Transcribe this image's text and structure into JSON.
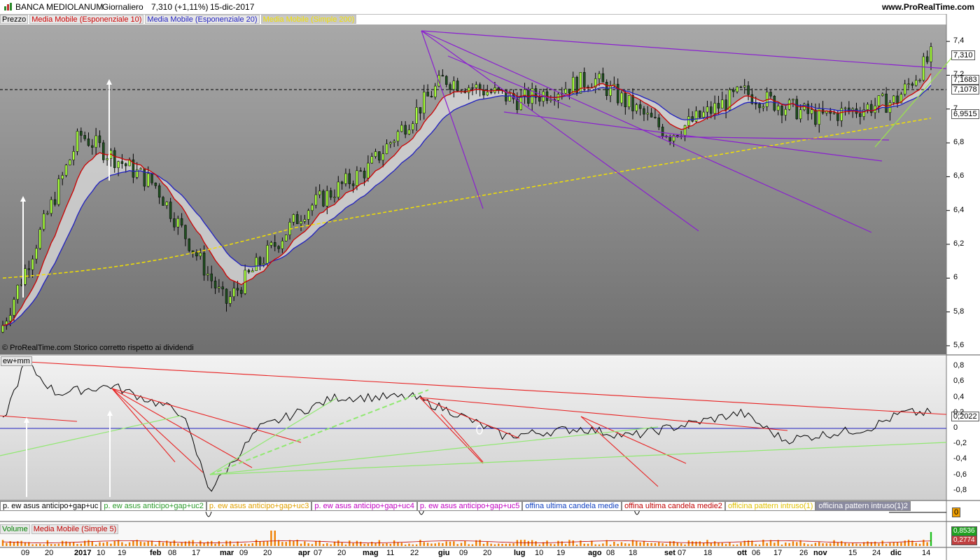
{
  "header": {
    "instrument": "BANCA MEDIOLANUM",
    "timeframe": "Giornaliero",
    "quote": "7,310 (+1,11%)",
    "date": "15-dic-2017",
    "site": "www.ProRealTime.com"
  },
  "legend": [
    {
      "label": "Prezzo",
      "color": "#000000"
    },
    {
      "label": "Media Mobile (Esponenziale 10)",
      "color": "#cc0000"
    },
    {
      "label": "Media Mobile (Esponenziale 20)",
      "color": "#1f1fbf"
    },
    {
      "label": "Media Mobile (Simple 200)",
      "color": "#f2e000"
    }
  ],
  "footnote": "© ProRealTime.com  Storico corretto rispetto ai dividendi",
  "price_axis": [
    "7,4",
    "7,2",
    "7",
    "6,8",
    "6,6",
    "6,4",
    "6,2",
    "6",
    "5,8",
    "5,6"
  ],
  "price_boxes": [
    {
      "value": "7,310",
      "bg": "#f2e000",
      "fg": "#000000"
    },
    {
      "value": "7,1683",
      "bg": "#c04040",
      "fg": "#ffffff"
    },
    {
      "value": "7,1078",
      "bg": "#2020c0",
      "fg": "#ffffff"
    },
    {
      "value": "6,9515",
      "bg": "#f2e000",
      "fg": "#000000"
    }
  ],
  "osc": {
    "name": "ew+mm",
    "axis": [
      "0,8",
      "0,6",
      "0,4",
      "0,2",
      "0",
      "-0,2",
      "-0,4",
      "-0,6",
      "-0,8"
    ],
    "last_value": "0,2022"
  },
  "signals": [
    {
      "label": "p. ew asus anticipo+gap+uc",
      "color": "#000000"
    },
    {
      "label": "p. ew asus anticipo+gap+uc2",
      "color": "#2a9a2a"
    },
    {
      "label": "p. ew asus anticipo+gap+uc3",
      "color": "#e0a000"
    },
    {
      "label": "p. ew asus anticipo+gap+uc4",
      "color": "#c000c0"
    },
    {
      "label": "p. ew asus anticipo+gap+uc5",
      "color": "#c000c0"
    },
    {
      "label": "offina ultima candela medie",
      "color": "#1040c0"
    },
    {
      "label": "offina ultima candela medie2",
      "color": "#c00000"
    },
    {
      "label": "officina pattern intruso(1)",
      "color": "#e0c000"
    },
    {
      "label": "officina pattern intruso(1)2",
      "color": "#ffffff"
    }
  ],
  "signal_value": "0",
  "volume": {
    "legend": [
      {
        "label": "Volume",
        "color": "#008000"
      },
      {
        "label": "Media Mobile (Simple 5)",
        "color": "#c00000"
      }
    ],
    "boxes": [
      {
        "value": "0,8536",
        "bg": "#20a020"
      },
      {
        "value": "0,2774",
        "bg": "#c04040"
      }
    ]
  },
  "x_axis": [
    {
      "label": "09",
      "bold": false
    },
    {
      "label": "20",
      "bold": false
    },
    {
      "label": "2017",
      "bold": true
    },
    {
      "label": "10",
      "bold": false
    },
    {
      "label": "19",
      "bold": false
    },
    {
      "label": "feb",
      "bold": true
    },
    {
      "label": "08",
      "bold": false
    },
    {
      "label": "17",
      "bold": false
    },
    {
      "label": "mar",
      "bold": true
    },
    {
      "label": "09",
      "bold": false
    },
    {
      "label": "20",
      "bold": false
    },
    {
      "label": "apr",
      "bold": true
    },
    {
      "label": "07",
      "bold": false
    },
    {
      "label": "20",
      "bold": false
    },
    {
      "label": "mag",
      "bold": true
    },
    {
      "label": "11",
      "bold": false
    },
    {
      "label": "22",
      "bold": false
    },
    {
      "label": "giu",
      "bold": true
    },
    {
      "label": "09",
      "bold": false
    },
    {
      "label": "20",
      "bold": false
    },
    {
      "label": "lug",
      "bold": true
    },
    {
      "label": "10",
      "bold": false
    },
    {
      "label": "19",
      "bold": false
    },
    {
      "label": "ago",
      "bold": true
    },
    {
      "label": "08",
      "bold": false
    },
    {
      "label": "18",
      "bold": false
    },
    {
      "label": "set",
      "bold": true
    },
    {
      "label": "07",
      "bold": false
    },
    {
      "label": "18",
      "bold": false
    },
    {
      "label": "ott",
      "bold": true
    },
    {
      "label": "06",
      "bold": false
    },
    {
      "label": "17",
      "bold": false
    },
    {
      "label": "26",
      "bold": false
    },
    {
      "label": "nov",
      "bold": true
    },
    {
      "label": "15",
      "bold": false
    },
    {
      "label": "24",
      "bold": false
    },
    {
      "label": "dic",
      "bold": true
    },
    {
      "label": "14",
      "bold": false
    }
  ],
  "chart_data": {
    "type": "line",
    "title": "BANCA MEDIOLANUM Giornaliero",
    "ylim": [
      5.55,
      7.5
    ],
    "anchor_dates": [
      "dic 2016 09",
      "2017",
      "feb",
      "mar",
      "apr",
      "mag",
      "giu",
      "lug",
      "ago",
      "set",
      "ott",
      "nov",
      "dic",
      "dic 14"
    ],
    "anchor_close": [
      5.68,
      6.85,
      6.55,
      5.85,
      6.4,
      6.65,
      7.18,
      7.05,
      7.18,
      6.85,
      7.1,
      6.95,
      7.05,
      7.31
    ],
    "ema10_last": 7.1683,
    "ema20_last": 7.1078,
    "sma200_last": 6.9515,
    "osc_last": 0.2022
  }
}
